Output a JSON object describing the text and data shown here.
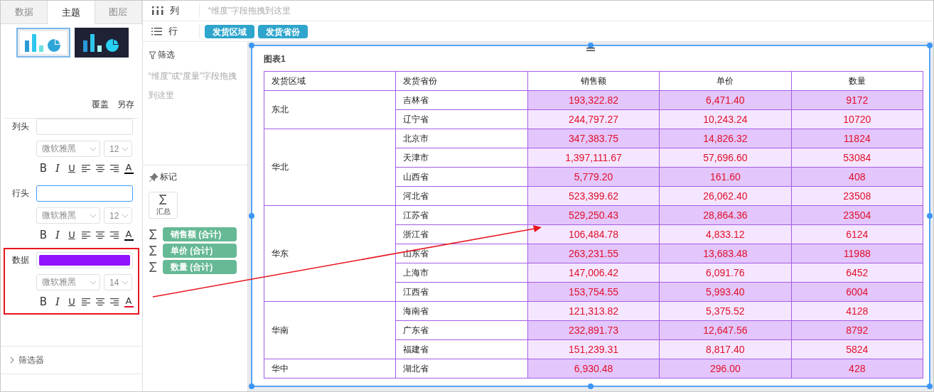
{
  "tabs": [
    {
      "label": "数据",
      "selected": false
    },
    {
      "label": "主题",
      "selected": true
    },
    {
      "label": "图层",
      "selected": false
    }
  ],
  "themes": [
    {
      "kind": "light",
      "selected": true
    },
    {
      "kind": "dark",
      "selected": false
    }
  ],
  "theme_actions": [
    "覆盖",
    "另存"
  ],
  "format_sections": [
    {
      "label": "列头",
      "kind": "text",
      "focused": false,
      "highlighted": false,
      "font": "微软雅黑",
      "size": "12",
      "tools": [
        "B",
        "I",
        "U"
      ],
      "color_letter": "A",
      "color": "#000000"
    },
    {
      "label": "行头",
      "kind": "text",
      "focused": true,
      "highlighted": false,
      "font": "微软雅黑",
      "size": "12",
      "tools": [
        "B",
        "I",
        "U"
      ],
      "color_letter": "A",
      "color": "#000000"
    },
    {
      "label": "数据",
      "kind": "color",
      "swatch": {
        "color": "#9012fe"
      },
      "highlighted": true,
      "font": "微软雅黑",
      "size": "14",
      "tools": [
        "B",
        "I",
        "U"
      ],
      "color_letter": "A",
      "color": "#e0102a"
    }
  ],
  "filter_panel": {
    "title": "筛选器",
    "expanded": false
  },
  "columns_shelf": {
    "label": "列",
    "hint": "“维度”字段拖拽到这里"
  },
  "rows_shelf": {
    "label": "行",
    "fields": [
      "发货区域",
      "发货省份"
    ]
  },
  "filter": {
    "title": "筛选",
    "hint": "“维度”或“度量”字段拖拽到这里"
  },
  "marks": {
    "title": "标记",
    "summary": "汇总",
    "measures": [
      "销售额 (合计)",
      "单价 (合计)",
      "数量 (合计)"
    ]
  },
  "chart": {
    "title": "图表1",
    "columns": [
      "发货区域",
      "发货省份",
      "销售额",
      "单价",
      "数量"
    ],
    "groups": [
      {
        "region": "东北",
        "rows": [
          {
            "province": "吉林省",
            "values": [
              "193,322.82",
              "6,471.40",
              "9172"
            ]
          },
          {
            "province": "辽宁省",
            "values": [
              "244,797.27",
              "10,243.24",
              "10720"
            ]
          }
        ]
      },
      {
        "region": "华北",
        "rows": [
          {
            "province": "北京市",
            "values": [
              "347,383.75",
              "14,826.32",
              "11824"
            ]
          },
          {
            "province": "天津市",
            "values": [
              "1,397,111.67",
              "57,696.60",
              "53084"
            ]
          },
          {
            "province": "山西省",
            "values": [
              "5,779.20",
              "161.60",
              "408"
            ]
          },
          {
            "province": "河北省",
            "values": [
              "523,399.62",
              "26,062.40",
              "23508"
            ]
          }
        ]
      },
      {
        "region": "华东",
        "rows": [
          {
            "province": "江苏省",
            "values": [
              "529,250.43",
              "28,864.36",
              "23504"
            ]
          },
          {
            "province": "浙江省",
            "values": [
              "106,484.78",
              "4,833.12",
              "6124"
            ]
          },
          {
            "province": "山东省",
            "values": [
              "263,231.55",
              "13,683.48",
              "11988"
            ]
          },
          {
            "province": "上海市",
            "values": [
              "147,006.42",
              "6,091.76",
              "6452"
            ]
          },
          {
            "province": "江西省",
            "values": [
              "153,754.55",
              "5,993.40",
              "6004"
            ]
          }
        ]
      },
      {
        "region": "华南",
        "rows": [
          {
            "province": "海南省",
            "values": [
              "121,313.82",
              "5,375.52",
              "4128"
            ]
          },
          {
            "province": "广东省",
            "values": [
              "232,891.73",
              "12,647.56",
              "8792"
            ]
          },
          {
            "province": "福建省",
            "values": [
              "151,239.31",
              "8,817.40",
              "5824"
            ]
          }
        ]
      },
      {
        "region": "华中",
        "rows": [
          {
            "province": "湖北省",
            "values": [
              "6,930.48",
              "296.00",
              "428"
            ]
          }
        ]
      }
    ]
  }
}
